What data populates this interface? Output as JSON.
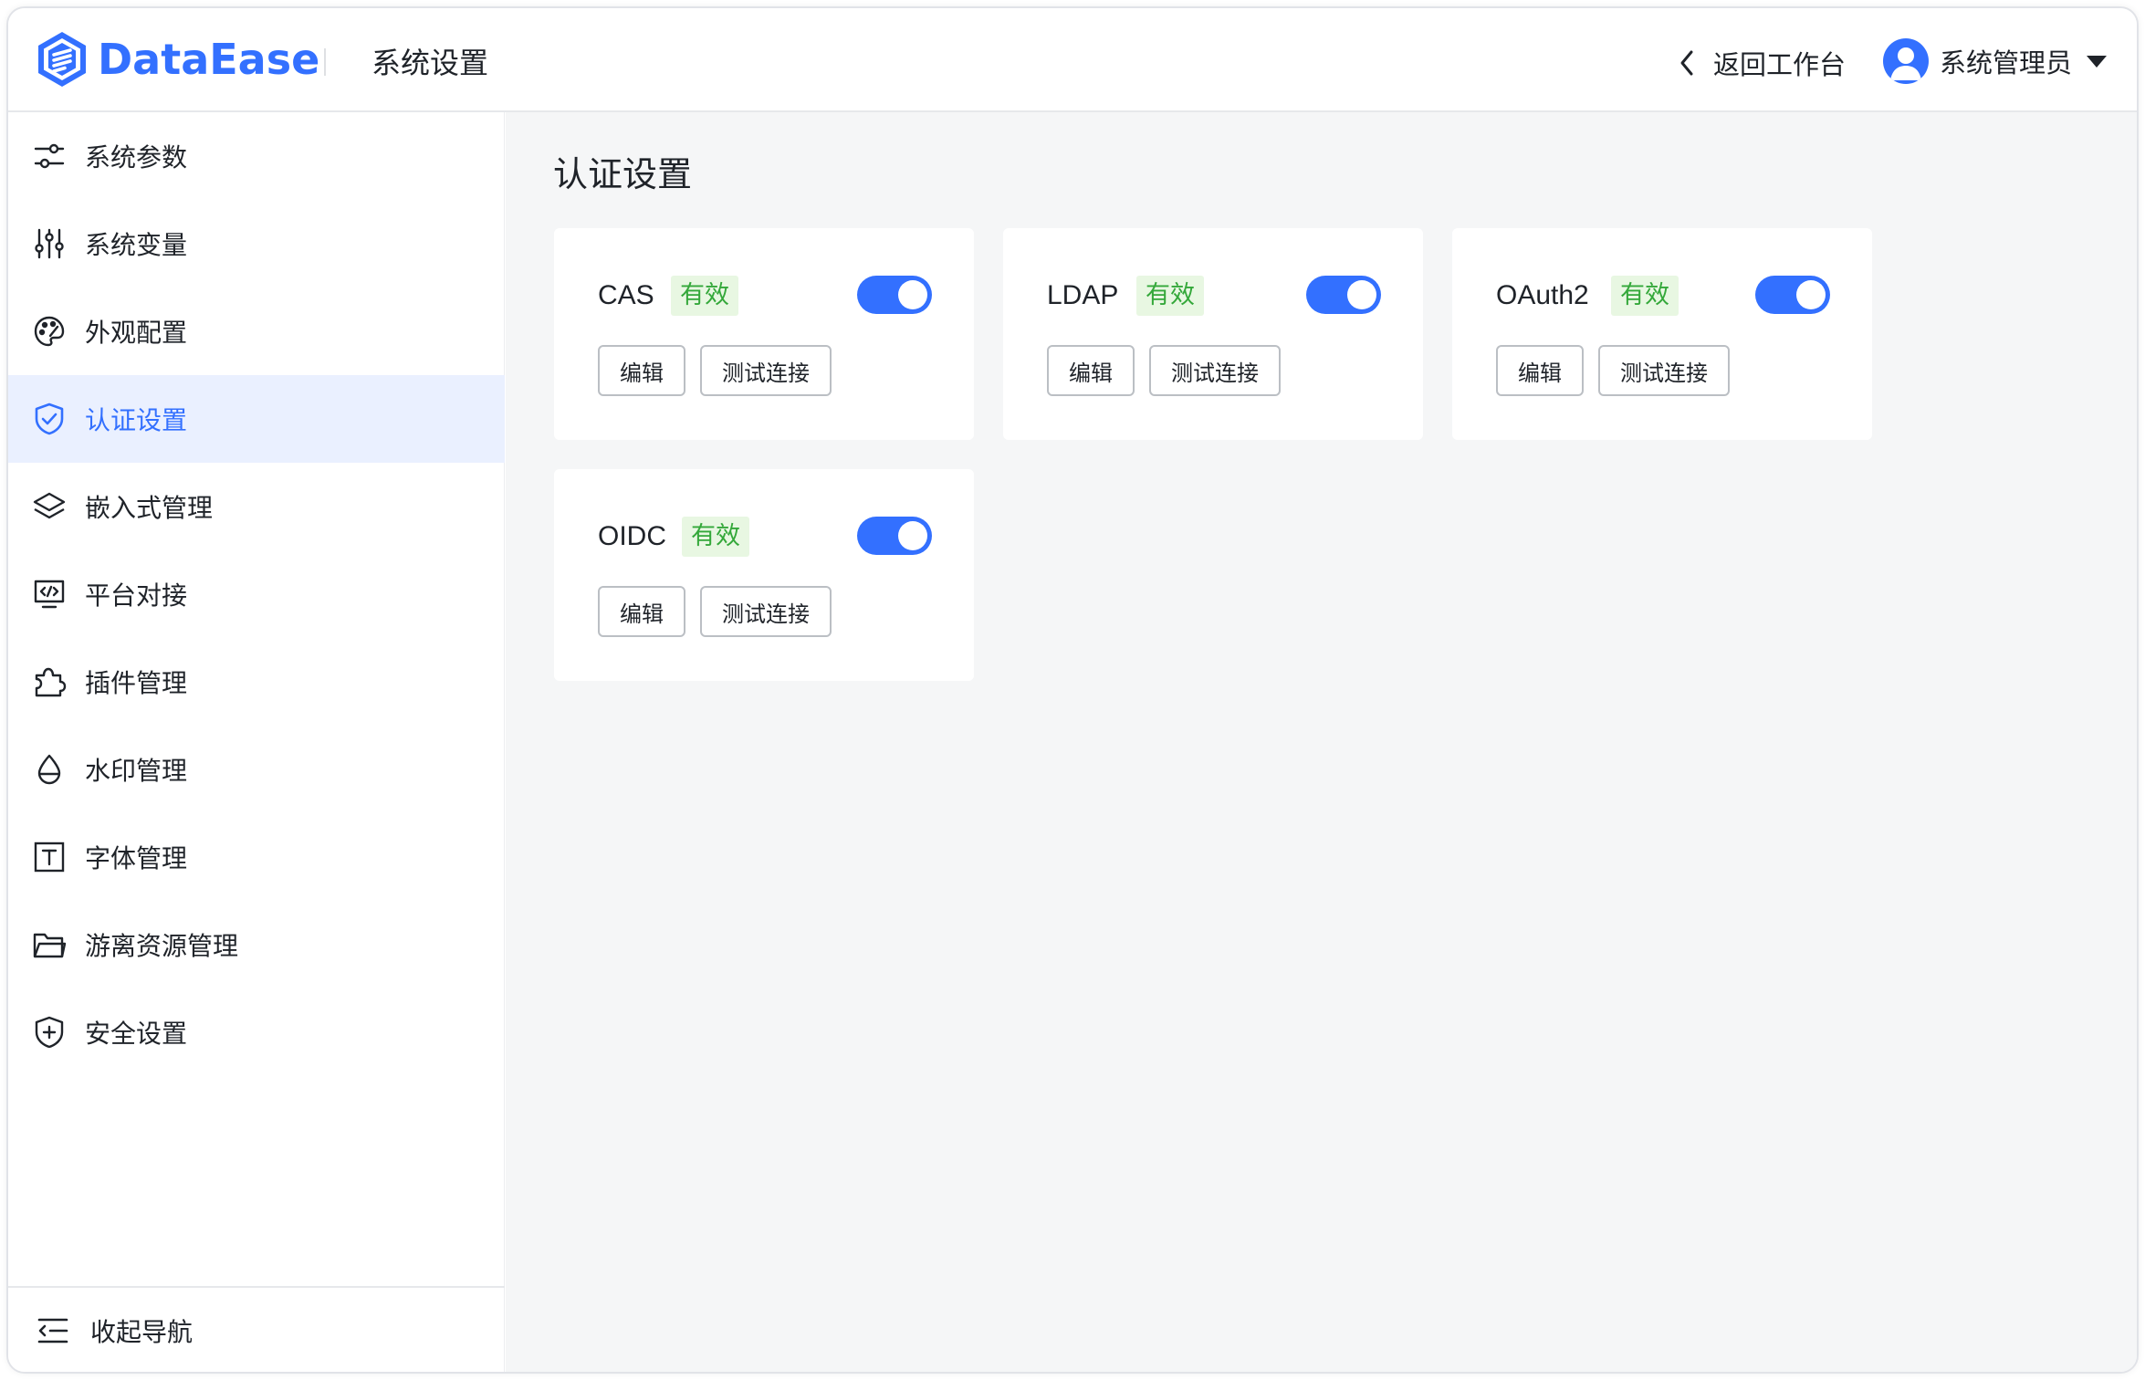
{
  "header": {
    "logo_text": "DataEase",
    "title": "系统设置",
    "back_label": "返回工作台",
    "user_name": "系统管理员"
  },
  "sidebar": {
    "items": [
      {
        "label": "系统参数",
        "icon": "sliders-icon"
      },
      {
        "label": "系统变量",
        "icon": "tune-icon"
      },
      {
        "label": "外观配置",
        "icon": "palette-icon"
      },
      {
        "label": "认证设置",
        "icon": "shield-check-icon",
        "active": true
      },
      {
        "label": "嵌入式管理",
        "icon": "layers-icon"
      },
      {
        "label": "平台对接",
        "icon": "code-screen-icon"
      },
      {
        "label": "插件管理",
        "icon": "puzzle-icon"
      },
      {
        "label": "水印管理",
        "icon": "drop-icon"
      },
      {
        "label": "字体管理",
        "icon": "font-icon"
      },
      {
        "label": "游离资源管理",
        "icon": "folder-icon"
      },
      {
        "label": "安全设置",
        "icon": "shield-plus-icon"
      }
    ],
    "collapse_label": "收起导航"
  },
  "main": {
    "title": "认证设置",
    "cards": [
      {
        "name": "CAS",
        "status": "有效",
        "enabled": true,
        "edit_label": "编辑",
        "test_label": "测试连接"
      },
      {
        "name": "LDAP",
        "status": "有效",
        "enabled": true,
        "edit_label": "编辑",
        "test_label": "测试连接"
      },
      {
        "name": "OAuth2",
        "status": "有效",
        "enabled": true,
        "edit_label": "编辑",
        "test_label": "测试连接"
      },
      {
        "name": "OIDC",
        "status": "有效",
        "enabled": true,
        "edit_label": "编辑",
        "test_label": "测试连接"
      }
    ]
  },
  "colors": {
    "accent": "#3370ff",
    "active_bg": "#eaf0ff",
    "badge_bg": "#e8f7e2",
    "badge_text": "#34a83a",
    "main_bg": "#f5f6f7"
  }
}
